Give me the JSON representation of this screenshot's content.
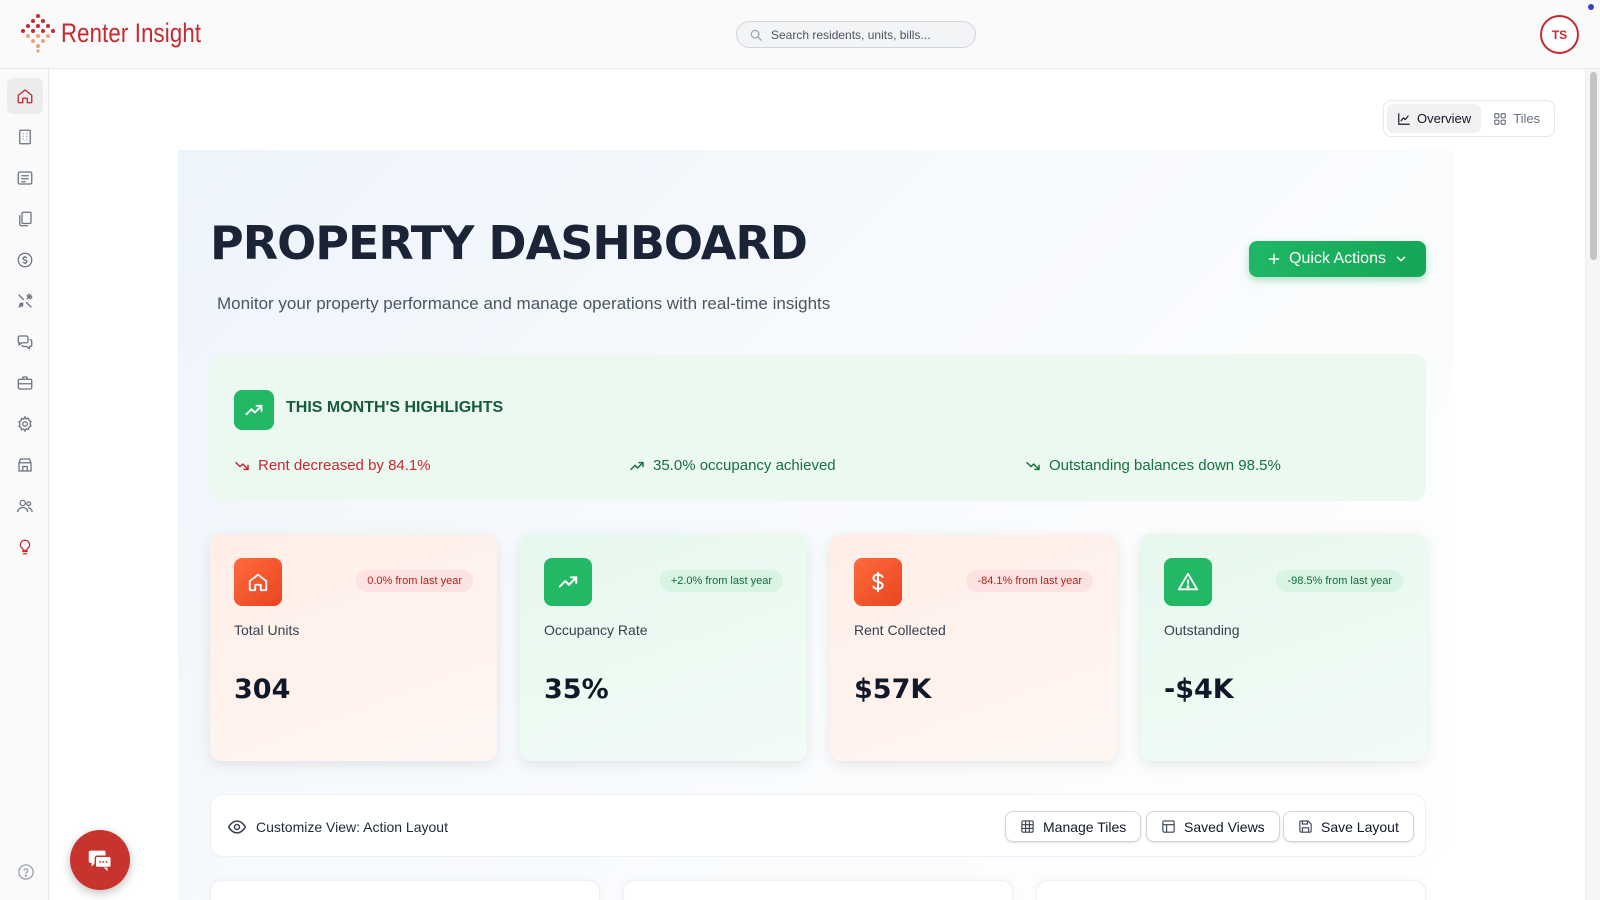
{
  "app": {
    "brand_name": "Renter Insight",
    "user_initials": "TS",
    "brand_color": "#c8282f",
    "accent_green": "#22b866"
  },
  "search": {
    "placeholder": "Search residents, units, bills..."
  },
  "sidebar": {
    "items": [
      {
        "icon": "home-icon",
        "active": true
      },
      {
        "icon": "building-icon",
        "active": false
      },
      {
        "icon": "list-icon",
        "active": false
      },
      {
        "icon": "documents-icon",
        "active": false
      },
      {
        "icon": "dollar-icon",
        "active": false
      },
      {
        "icon": "tools-icon",
        "active": false
      },
      {
        "icon": "chat-icon",
        "active": false
      },
      {
        "icon": "briefcase-icon",
        "active": false
      },
      {
        "icon": "gear-icon",
        "active": false
      },
      {
        "icon": "store-icon",
        "active": false
      },
      {
        "icon": "users-icon",
        "active": false
      },
      {
        "icon": "lightbulb-icon",
        "active": false
      }
    ],
    "help_icon": "help-icon"
  },
  "view_toggle": {
    "overview_label": "Overview",
    "tiles_label": "Tiles",
    "selected": "Overview"
  },
  "header": {
    "title": "PROPERTY DASHBOARD",
    "subtitle": "Monitor your property performance and manage operations with real-time insights",
    "quick_actions_label": "Quick Actions"
  },
  "highlights": {
    "title": "THIS MONTH'S HIGHLIGHTS",
    "items": [
      {
        "text": "Rent decreased by 84.1%",
        "trend": "down",
        "tone": "negative"
      },
      {
        "text": "35.0% occupancy achieved",
        "trend": "up",
        "tone": "positive"
      },
      {
        "text": "Outstanding balances down 98.5%",
        "trend": "down",
        "tone": "positive"
      }
    ]
  },
  "stats": [
    {
      "label": "Total Units",
      "value": "304",
      "badge": "0.0% from last year",
      "badge_tone": "red",
      "icon": "home-icon"
    },
    {
      "label": "Occupancy Rate",
      "value": "35%",
      "badge": "+2.0% from last year",
      "badge_tone": "green",
      "icon": "trending-up-icon"
    },
    {
      "label": "Rent Collected",
      "value": "$57K",
      "badge": "-84.1% from last year",
      "badge_tone": "red",
      "icon": "dollar-icon"
    },
    {
      "label": "Outstanding",
      "value": "-$4K",
      "badge": "-98.5% from last year",
      "badge_tone": "green",
      "icon": "warning-icon"
    }
  ],
  "customize": {
    "label": "Customize View: Action Layout",
    "manage_tiles_label": "Manage Tiles",
    "saved_views_label": "Saved Views",
    "save_layout_label": "Save Layout"
  }
}
